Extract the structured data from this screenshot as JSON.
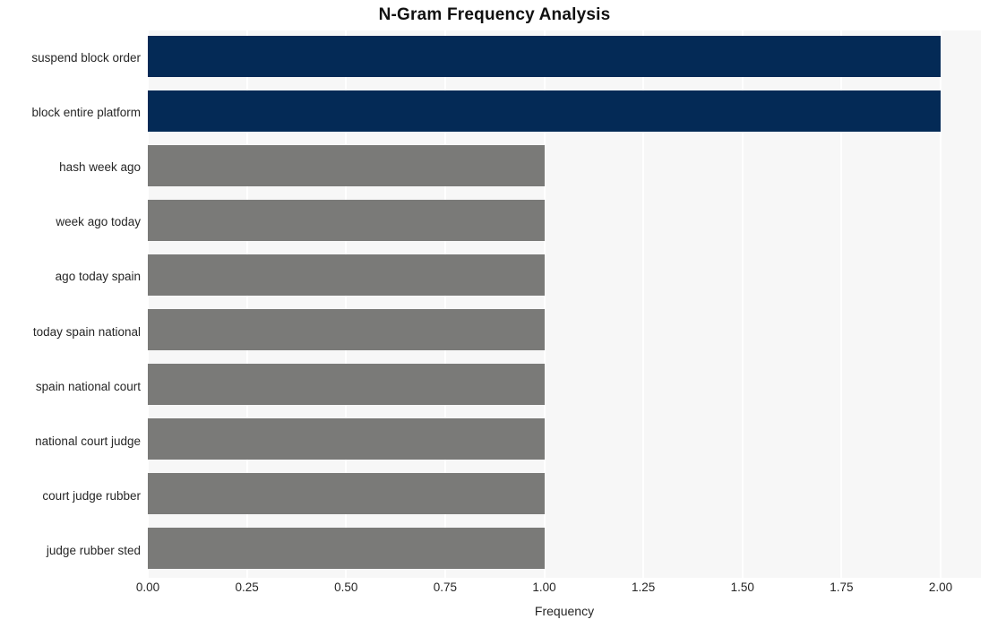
{
  "chart_data": {
    "type": "bar",
    "orientation": "horizontal",
    "title": "N-Gram Frequency Analysis",
    "xlabel": "Frequency",
    "ylabel": "",
    "xlim": [
      0,
      2
    ],
    "xticks": [
      "0.00",
      "0.25",
      "0.50",
      "0.75",
      "1.00",
      "1.25",
      "1.50",
      "1.75",
      "2.00"
    ],
    "xtick_values": [
      0,
      0.25,
      0.5,
      0.75,
      1.0,
      1.25,
      1.5,
      1.75,
      2.0
    ],
    "grid": true,
    "legend": null,
    "categories": [
      "suspend block order",
      "block entire platform",
      "hash week ago",
      "week ago today",
      "ago today spain",
      "today spain national",
      "spain national court",
      "national court judge",
      "court judge rubber",
      "judge rubber sted"
    ],
    "values": [
      2,
      2,
      1,
      1,
      1,
      1,
      1,
      1,
      1,
      1
    ],
    "bar_colors": [
      "#042a56",
      "#042a56",
      "#7a7a78",
      "#7a7a78",
      "#7a7a78",
      "#7a7a78",
      "#7a7a78",
      "#7a7a78",
      "#7a7a78",
      "#7a7a78"
    ]
  },
  "style": {
    "plot_background": "#f7f7f7",
    "figure_background": "#ffffff",
    "gridline_color": "#ffffff",
    "highlight_color": "#042a56",
    "default_bar_color": "#7a7a78",
    "text_color": "#262626",
    "title_color": "#111111"
  }
}
